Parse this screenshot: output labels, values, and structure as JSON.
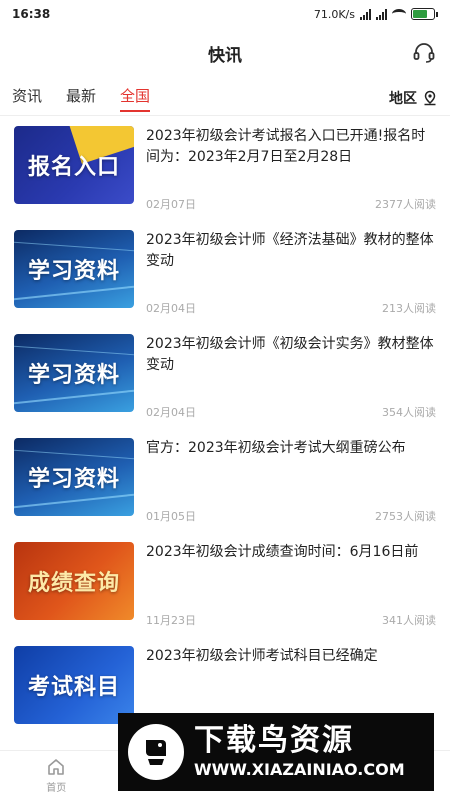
{
  "status_bar": {
    "time": "16:38",
    "network_speed": "71.0K/s",
    "battery_color": "#2e9c3f"
  },
  "header": {
    "title": "快讯",
    "support_icon": "headset-icon"
  },
  "tabs": [
    {
      "label": "资讯",
      "active": false
    },
    {
      "label": "最新",
      "active": false
    },
    {
      "label": "全国",
      "active": true
    }
  ],
  "region": {
    "label": "地区",
    "icon": "location-pin-icon"
  },
  "accent_color": "#e3342f",
  "articles": [
    {
      "thumb": "报名入口",
      "title": "2023年初级会计考试报名入口已开通!报名时间为：2023年2月7日至2月28日",
      "date": "02月07日",
      "reads": "2377人阅读"
    },
    {
      "thumb": "学习资料",
      "title": "2023年初级会计师《经济法基础》教材的整体变动",
      "date": "02月04日",
      "reads": "213人阅读"
    },
    {
      "thumb": "学习资料",
      "title": "2023年初级会计师《初级会计实务》教材整体变动",
      "date": "02月04日",
      "reads": "354人阅读"
    },
    {
      "thumb": "学习资料",
      "title": "官方：2023年初级会计考试大纲重磅公布",
      "date": "01月05日",
      "reads": "2753人阅读"
    },
    {
      "thumb": "成绩查询",
      "title": "2023年初级会计成绩查询时间：6月16日前",
      "date": "11月23日",
      "reads": "341人阅读"
    },
    {
      "thumb": "考试科目",
      "title": "2023年初级会计师考试科目已经确定",
      "date": "",
      "reads": ""
    }
  ],
  "bottom_nav": [
    {
      "label": "首页",
      "icon": "home-icon"
    }
  ],
  "watermark": {
    "title": "下载鸟资源",
    "url": "WWW.XIAZAINIAO.COM"
  }
}
